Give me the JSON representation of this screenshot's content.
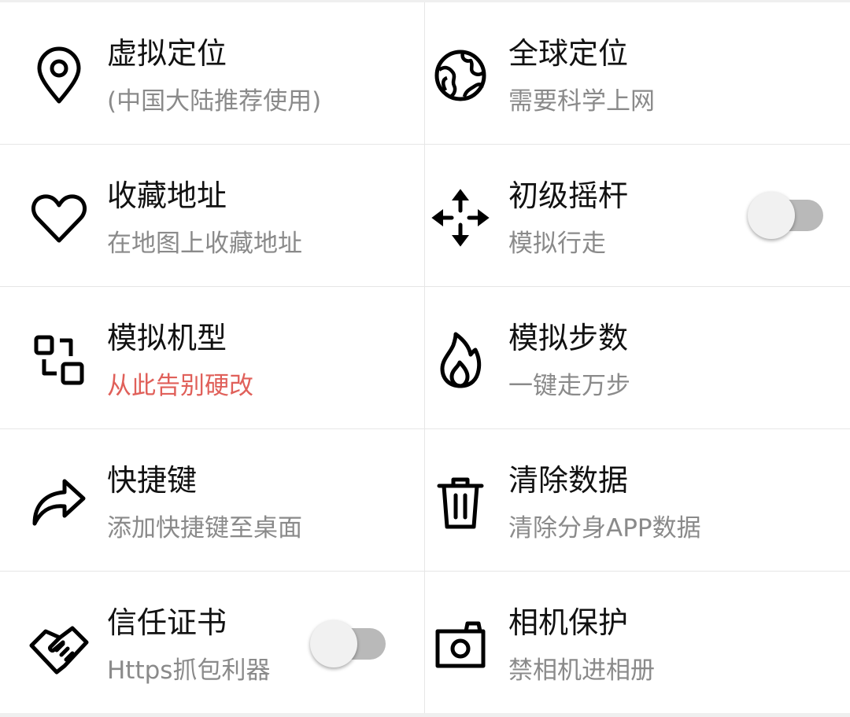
{
  "colors": {
    "background": "#ffffff",
    "divider": "#e6e6e6",
    "title": "#111111",
    "subtitle": "#8a8a8a",
    "accent_subtitle": "#e0605a",
    "toggle_off_track": "#b9b9b9",
    "toggle_off_knob": "#f1f1f1"
  },
  "items": [
    {
      "title": "虚拟定位",
      "subtitle": "(中国大陆推荐使用)",
      "icon": "location-pin-icon"
    },
    {
      "title": "全球定位",
      "subtitle": "需要科学上网",
      "icon": "globe-icon"
    },
    {
      "title": "收藏地址",
      "subtitle": "在地图上收藏地址",
      "icon": "heart-icon"
    },
    {
      "title": "初级摇杆",
      "subtitle": "模拟行走",
      "icon": "move-arrows-icon",
      "toggle": "off"
    },
    {
      "title": "模拟机型",
      "subtitle": "从此告别硬改",
      "icon": "devices-icon",
      "subtitle_color": "#e0605a"
    },
    {
      "title": "模拟步数",
      "subtitle": "一键走万步",
      "icon": "flame-icon"
    },
    {
      "title": "快捷键",
      "subtitle": "添加快捷键至桌面",
      "icon": "share-arrow-icon"
    },
    {
      "title": "清除数据",
      "subtitle": "清除分身APP数据",
      "icon": "trash-icon"
    },
    {
      "title": "信任证书",
      "subtitle": "Https抓包利器",
      "icon": "handshake-icon",
      "toggle": "off"
    },
    {
      "title": "相机保护",
      "subtitle": "禁相机进相册",
      "icon": "camera-icon"
    }
  ]
}
